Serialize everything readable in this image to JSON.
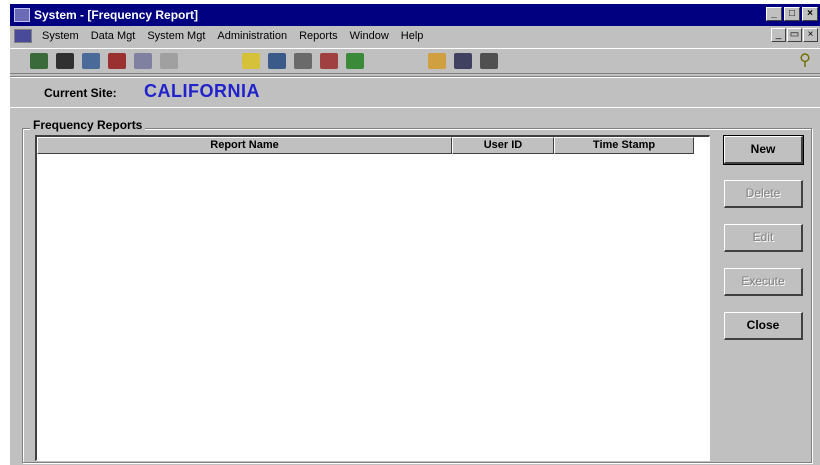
{
  "window": {
    "title": "System - [Frequency Report]",
    "controls": {
      "minimize": "_",
      "maximize": "□",
      "close": "×"
    },
    "mdi_controls": {
      "minimize": "_",
      "restore": "▭",
      "close": "×"
    }
  },
  "menubar": {
    "items": [
      {
        "label": "System"
      },
      {
        "label": "Data Mgt"
      },
      {
        "label": "System Mgt"
      },
      {
        "label": "Administration"
      },
      {
        "label": "Reports"
      },
      {
        "label": "Window"
      },
      {
        "label": "Help"
      }
    ]
  },
  "toolbar": {
    "icons": [
      "tree-icon",
      "binoculars-icon",
      "network-icon",
      "chart-icon",
      "copy-window-icon",
      "help-arrow-icon",
      "mail-icon",
      "tools-icon",
      "settings-icon",
      "query-icon",
      "folder-icon",
      "clipboard-icon",
      "grid-icon",
      "calendar-icon",
      "key-icon"
    ],
    "key_glyph": "⚲"
  },
  "site": {
    "label": "Current Site:",
    "value": "CALIFORNIA"
  },
  "group": {
    "title": "Frequency Reports"
  },
  "table": {
    "columns": [
      "Report Name",
      "User ID",
      "Time Stamp"
    ],
    "rows": []
  },
  "buttons": {
    "new": "New",
    "delete": "Delete",
    "edit": "Edit",
    "execute": "Execute",
    "close": "Close"
  },
  "colors": {
    "titlebar": "#000080",
    "window_face": "#c0c0c0",
    "site_value": "#2222cc"
  }
}
